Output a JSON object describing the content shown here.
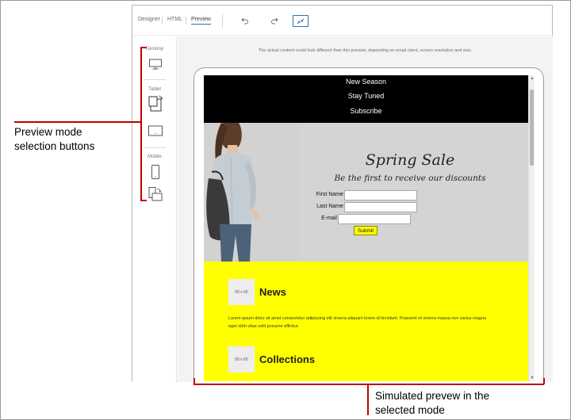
{
  "toolbar": {
    "tabs": [
      {
        "label": "Designer"
      },
      {
        "label": "HTML"
      },
      {
        "label": "Preview",
        "active": true
      }
    ],
    "icons": [
      "undo-icon",
      "redo-icon",
      "fit-screen-icon"
    ]
  },
  "mode_rail": {
    "desktop_label": "Desktop",
    "tablet_label": "Tablet",
    "mobile_label": "Mobile",
    "buttons": [
      "desktop-icon",
      "tablet-rotate-icon",
      "tablet-landscape-icon",
      "mobile-portrait-icon",
      "mobile-rotate-icon"
    ]
  },
  "preview": {
    "disclaimer": "The actual content could look different than this preview, depending on email client, screen resolution and size."
  },
  "email": {
    "nav": [
      "New Season",
      "Stay Tuned",
      "Subscribe"
    ],
    "hero_title": "Spring Sale",
    "hero_subtitle": "Be the first to receive our discounts",
    "form": {
      "first_name_label": "First Name",
      "last_name_label": "Last Name",
      "email_label": "E-mail",
      "submit_label": "Submit"
    },
    "sections": [
      {
        "thumb": "60 x 60",
        "title": "News",
        "body": "Lorem ipsum dolor sit amet consectetur adipiscing elit viverra aliquam lorem id tincidunt. Praesent et viverra massa non varius magna eget nibh vitae velit posuere efficitur."
      },
      {
        "thumb": "60 x 60",
        "title": "Collections"
      }
    ]
  },
  "callouts": {
    "left": "Preview mode selection buttons",
    "left_line1": "Preview mode",
    "left_line2": "selection buttons",
    "bottom_line1": "Simulated prevew in the",
    "bottom_line2": "selected mode"
  },
  "colors": {
    "accent": "#2f6fb2",
    "callout": "#c00000",
    "email_nav_bg": "#000000",
    "email_content_bg": "#ffff00",
    "hero_bg": "#d4d4d4"
  }
}
